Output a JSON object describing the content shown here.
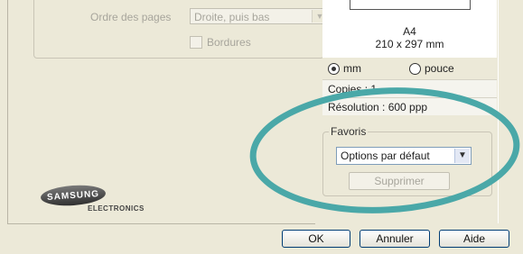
{
  "layout": {
    "page_order_label": "Ordre des pages",
    "page_order_value": "Droite, puis bas",
    "borders_label": "Bordures"
  },
  "logo": {
    "brand": "SAMSUNG",
    "sub": "ELECTRONICS"
  },
  "preview": {
    "paper_name": "A4",
    "paper_dims": "210 x 297 mm"
  },
  "units": {
    "mm_label": "mm",
    "inch_label": "pouce",
    "selected": "mm"
  },
  "info": {
    "copies": "Copies : 1",
    "resolution": "Résolution : 600 ppp"
  },
  "favorites": {
    "legend": "Favoris",
    "selected": "Options par défaut",
    "delete_label": "Supprimer"
  },
  "footer": {
    "ok_label": "OK",
    "cancel_label": "Annuler",
    "help_label": "Aide"
  },
  "colors": {
    "dialog_bg": "#ece9d8",
    "annotation": "#4aa8a8"
  }
}
